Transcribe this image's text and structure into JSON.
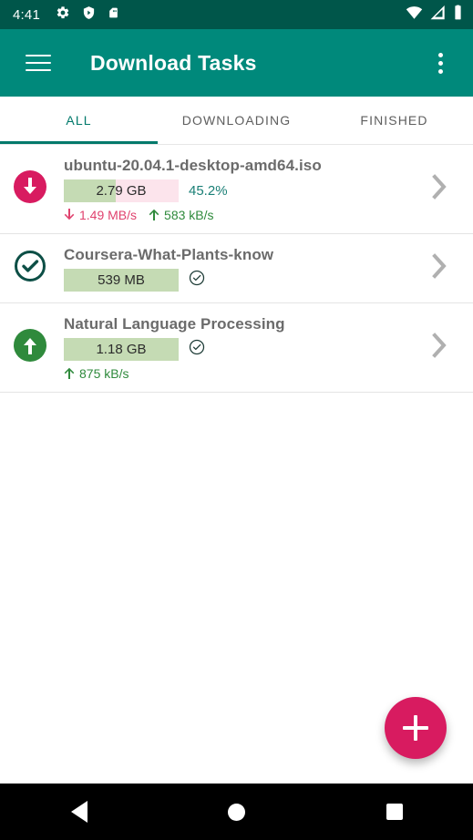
{
  "status_bar": {
    "clock": "4:41",
    "left_icons": [
      "gear-icon",
      "shield-play-icon",
      "sd-card-icon"
    ],
    "right_icons": [
      "wifi-icon",
      "cellular-signal-icon",
      "battery-icon"
    ],
    "background_color": "#00564a"
  },
  "app_bar": {
    "title": "Download Tasks",
    "menu_icon": "hamburger-menu-icon",
    "overflow_icon": "overflow-menu-icon",
    "background_color": "#00897b",
    "text_color": "#ffffff"
  },
  "tabs": {
    "active_index": 0,
    "active_color": "#00796b",
    "inactive_color": "#5e5e5e",
    "items": [
      {
        "label": "ALL"
      },
      {
        "label": "DOWNLOADING"
      },
      {
        "label": "FINISHED"
      }
    ]
  },
  "tasks": [
    {
      "title": "ubuntu-20.04.1-desktop-amd64.iso",
      "status_icon": "download-circle-icon",
      "status_icon_color": "#d81b60",
      "size_label": "2.79 GB",
      "percent_label": "45.2%",
      "progress_percent": 45.2,
      "progress_fill_color": "#c5dbb4",
      "progress_track_color": "#fce4ec",
      "has_check_badge": false,
      "download_speed": "1.49 MB/s",
      "upload_speed": "583 kB/s",
      "download_speed_color": "#e0426e",
      "upload_speed_color": "#2f8a3c",
      "chevron_icon": "chevron-right-icon"
    },
    {
      "title": "Coursera-What-Plants-know",
      "status_icon": "check-circle-outline-icon",
      "status_icon_color": "#0d4f46",
      "size_label": "539 MB",
      "percent_label": "",
      "progress_percent": 100,
      "progress_fill_color": "#c5dbb4",
      "progress_track_color": "#c5dbb4",
      "has_check_badge": true,
      "download_speed": "",
      "upload_speed": "",
      "download_speed_color": "#e0426e",
      "upload_speed_color": "#2f8a3c",
      "chevron_icon": "chevron-right-icon"
    },
    {
      "title": "Natural Language Processing",
      "status_icon": "upload-circle-filled-icon",
      "status_icon_color": "#2f8a3c",
      "size_label": "1.18 GB",
      "percent_label": "",
      "progress_percent": 100,
      "progress_fill_color": "#c5dbb4",
      "progress_track_color": "#c5dbb4",
      "has_check_badge": true,
      "download_speed": "",
      "upload_speed": "875 kB/s",
      "download_speed_color": "#e0426e",
      "upload_speed_color": "#2f8a3c",
      "chevron_icon": "chevron-right-icon"
    }
  ],
  "fab": {
    "icon": "plus-icon",
    "color": "#d81b60"
  },
  "nav_bar": {
    "background_color": "#000000",
    "buttons": [
      {
        "icon": "back-triangle-icon"
      },
      {
        "icon": "home-circle-icon"
      },
      {
        "icon": "recents-square-icon"
      }
    ]
  }
}
